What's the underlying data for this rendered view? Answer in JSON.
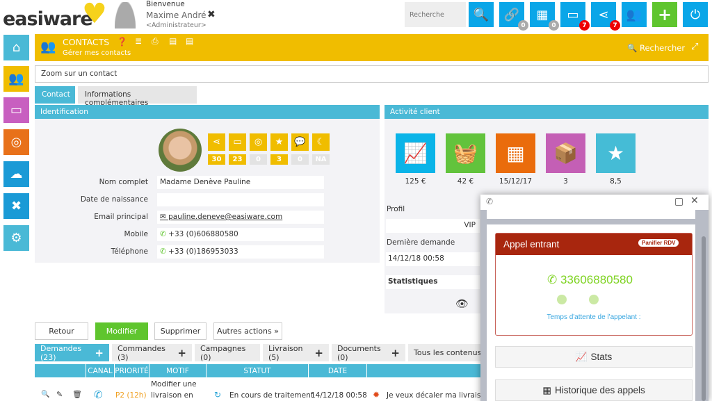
{
  "header": {
    "logo": "easiware",
    "welcome": "Bienvenue",
    "user_name": "Maxime André",
    "role": "<Administrateur>",
    "search_placeholder": "Recherche",
    "badges": {
      "links": "0",
      "calendar": "0",
      "screen": "7",
      "share": "7"
    }
  },
  "module": {
    "title": "CONTACTS",
    "subtitle": "Gérer mes contacts",
    "search_label": "Rechercher"
  },
  "zoom_field": {
    "value": "Zoom sur un contact"
  },
  "tabs": [
    {
      "label": "Contact",
      "active": true
    },
    {
      "label": "Informations complémentaires"
    }
  ],
  "identification": {
    "title": "Identification",
    "counters": [
      {
        "icon": "share-icon",
        "value": "30",
        "active": true
      },
      {
        "icon": "inbox-icon",
        "value": "23",
        "active": true
      },
      {
        "icon": "target-icon",
        "value": "0",
        "active": false
      },
      {
        "icon": "star-icon",
        "value": "3",
        "active": true
      },
      {
        "icon": "chat-icon",
        "value": "0",
        "active": false
      },
      {
        "icon": "megaphone-icon",
        "value": "NA",
        "active": false
      }
    ],
    "fields": [
      {
        "label": "Nom complet",
        "value": "Madame Denève Pauline"
      },
      {
        "label": "Date de naissance",
        "value": ""
      },
      {
        "label": "Email principal",
        "value": "pauline.deneve@easiware.com"
      },
      {
        "label": "Mobile",
        "value": "+33 (0)606880580"
      },
      {
        "label": "Téléphone",
        "value": "+33 (0)186953033"
      }
    ]
  },
  "activity": {
    "title": "Activité client",
    "kpis": [
      {
        "icon": "trend-icon",
        "value": "125 €",
        "color": "#0ab4e8"
      },
      {
        "icon": "basket-icon",
        "value": "42 €",
        "color": "#62c33c"
      },
      {
        "icon": "calendar-icon",
        "value": "15/12/17",
        "color": "#ea6c0c"
      },
      {
        "icon": "box-icon",
        "value": "3",
        "color": "#c45fb5"
      },
      {
        "icon": "star-icon",
        "value": "8,5",
        "color": "#45bcd6"
      }
    ],
    "profil_label": "Profil",
    "profil_value": "VIP",
    "last_request_label": "Dernière demande",
    "last_request_value": "14/12/18 00:58",
    "stats_label": "Statistiques"
  },
  "actions": {
    "back": "Retour",
    "edit": "Modifier",
    "delete": "Supprimer",
    "more": "Autres actions »"
  },
  "subtabs": [
    {
      "label": "Demandes (23)",
      "plus": true,
      "active": true
    },
    {
      "label": "Commandes (3)",
      "plus": true
    },
    {
      "label": "Campagnes (0)",
      "plus": false
    },
    {
      "label": "Livraison (5)",
      "plus": true
    },
    {
      "label": "Documents (0)",
      "plus": true
    },
    {
      "label": "Tous les contenus",
      "plus": false
    }
  ],
  "table": {
    "columns": [
      "",
      "CANAL",
      "PRIORITÉ",
      "MOTIF",
      "STATUT",
      "DATE",
      ""
    ],
    "rows": [
      {
        "priority": "P2 (12h)",
        "motif_line1": "Modifier une",
        "motif_line2": "livraison en",
        "status": "En cours de traitement",
        "date": "14/12/18 00:58",
        "subject": "Je veux décaler ma livraison"
      }
    ]
  },
  "call_popup": {
    "title": "Appel entrant",
    "badge": "Panifier RDV",
    "number": "33606880580",
    "wait_label": "Temps d'attente de l'appelant :",
    "stats_button": "Stats",
    "history_button": "Historique des appels"
  },
  "colors": {
    "blue": "#4ab9d6",
    "yellow": "#f0bd00",
    "green": "#5fc52e",
    "call_red": "#a8260e"
  }
}
